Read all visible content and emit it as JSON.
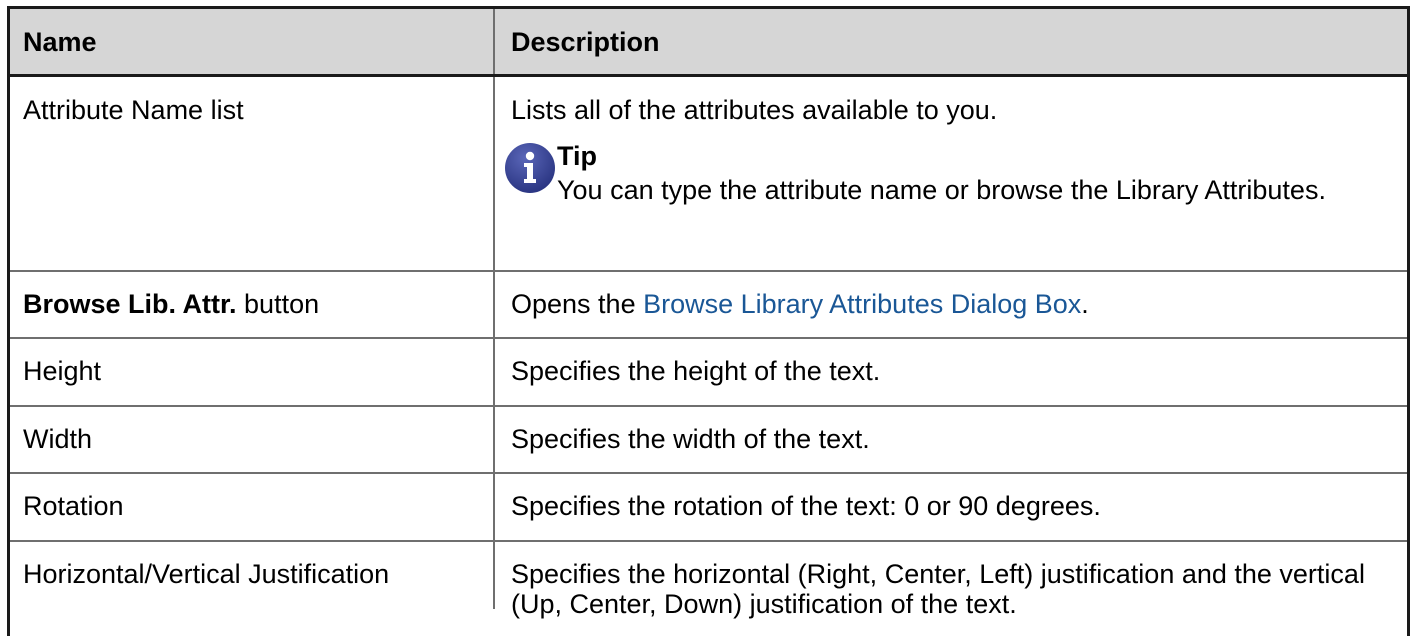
{
  "header": {
    "name": "Name",
    "description": "Description"
  },
  "rows": [
    {
      "name": "Attribute Name list",
      "description": "Lists all of the attributes available to you.",
      "tip": {
        "icon": "info-icon",
        "title": "Tip",
        "body": "You can type the attribute name or browse the Library Attributes."
      }
    },
    {
      "name_bold": "Browse Lib. Attr.",
      "name_rest": " button",
      "description_prefix": "Opens the ",
      "description_link": "Browse Library Attributes Dialog Box",
      "description_suffix": "."
    },
    {
      "name": "Height",
      "description": "Specifies the height of the text."
    },
    {
      "name": "Width",
      "description": "Specifies the width of the text."
    },
    {
      "name": "Rotation",
      "description": "Specifies the rotation of the text: 0 or 90 degrees."
    },
    {
      "name": "Horizontal/Vertical Justification",
      "description": "Specifies the horizontal (Right, Center, Left) justification and the vertical (Up, Center, Down) justification of the text."
    }
  ],
  "colors": {
    "header_bg": "#d6d6d6",
    "link": "#1a5796",
    "tip_icon": "#2e3a8c"
  }
}
